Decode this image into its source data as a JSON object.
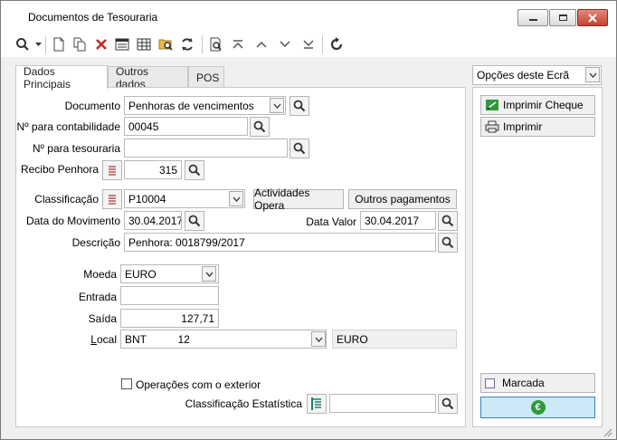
{
  "window": {
    "title": "Documentos de Tesouraria"
  },
  "tabs": [
    {
      "label": "Dados Principais"
    },
    {
      "label": "Outros dados"
    },
    {
      "label": "POS"
    }
  ],
  "form": {
    "documento": {
      "label": "Documento",
      "value": "Penhoras de vencimentos"
    },
    "num_contabilidade": {
      "label": "Nº para contabilidade",
      "value": "00045"
    },
    "num_tesouraria": {
      "label": "Nº para tesouraria",
      "value": ""
    },
    "recibo_penhora": {
      "label": "Recibo Penhora",
      "value": "315"
    },
    "classificacao": {
      "label": "Classificação",
      "value": "P10004",
      "btn_actividades": "Actividades Opera",
      "btn_outros": "Outros pagamentos"
    },
    "data_movimento": {
      "label": "Data do Movimento",
      "value": "30.04.2017"
    },
    "data_valor": {
      "label": "Data Valor",
      "value": "30.04.2017"
    },
    "descricao": {
      "label": "Descrição",
      "value": "Penhora: 0018799/2017"
    },
    "moeda": {
      "label": "Moeda",
      "value": "EURO"
    },
    "entrada": {
      "label": "Entrada",
      "value": ""
    },
    "saida": {
      "label": "Saída",
      "value": "127,71"
    },
    "local": {
      "label_first": "L",
      "label_rest": "ocal",
      "code": "BNT",
      "number": "12",
      "currency": "EURO"
    },
    "operacoes_exterior": {
      "label": "Operações com o exterior",
      "checked": false
    },
    "class_estatistica": {
      "label": "Classificação Estatística",
      "value": ""
    }
  },
  "sidebar": {
    "options_label": "Opções deste Ecrã",
    "imprimir_cheque": "Imprimir Cheque",
    "imprimir": "Imprimir",
    "marcada": "Marcada",
    "currency_symbol": "€"
  },
  "colors": {
    "accent_green": "#2e9a3c",
    "confirm_bg": "#cde8f6",
    "confirm_border": "#3c7fb1"
  }
}
